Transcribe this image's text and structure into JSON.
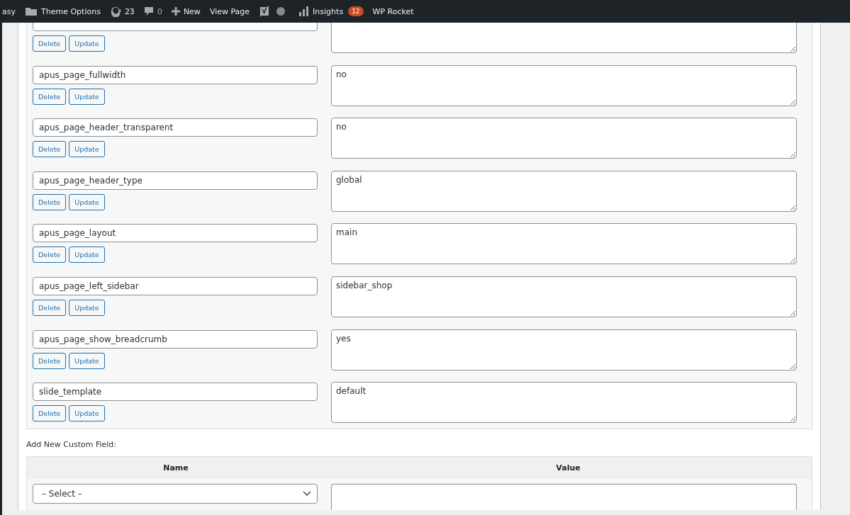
{
  "admin_bar": [
    {
      "kind": "text",
      "label": "asy"
    },
    {
      "kind": "folder",
      "label": "Theme Options"
    },
    {
      "kind": "updates",
      "label": "23"
    },
    {
      "kind": "comments",
      "label": "0"
    },
    {
      "kind": "new",
      "label": "New"
    },
    {
      "kind": "text",
      "label": "View Page"
    },
    {
      "kind": "seo"
    },
    {
      "kind": "insights",
      "label": "Insights",
      "badge": "12"
    },
    {
      "kind": "text",
      "label": "WP Rocket"
    }
  ],
  "custom_fields": [
    {
      "buttons": [
        "Delete",
        "Update"
      ]
    },
    {
      "name": "apus_page_fullwidth",
      "value": "no",
      "buttons": [
        "Delete",
        "Update"
      ]
    },
    {
      "name": "apus_page_header_transparent",
      "value": "no",
      "buttons": [
        "Delete",
        "Update"
      ]
    },
    {
      "name": "apus_page_header_type",
      "value": "global",
      "buttons": [
        "Delete",
        "Update"
      ]
    },
    {
      "name": "apus_page_layout",
      "value": "main",
      "buttons": [
        "Delete",
        "Update"
      ]
    },
    {
      "name": "apus_page_left_sidebar",
      "value": "sidebar_shop",
      "buttons": [
        "Delete",
        "Update"
      ]
    },
    {
      "name": "apus_page_show_breadcrumb",
      "value": "yes",
      "buttons": [
        "Delete",
        "Update"
      ]
    },
    {
      "name": "slide_template",
      "value": "default",
      "buttons": [
        "Delete",
        "Update"
      ]
    }
  ],
  "new_field": {
    "title": "Add New Custom Field:",
    "columns": [
      "Name",
      "Value"
    ],
    "select": "– Select –"
  }
}
